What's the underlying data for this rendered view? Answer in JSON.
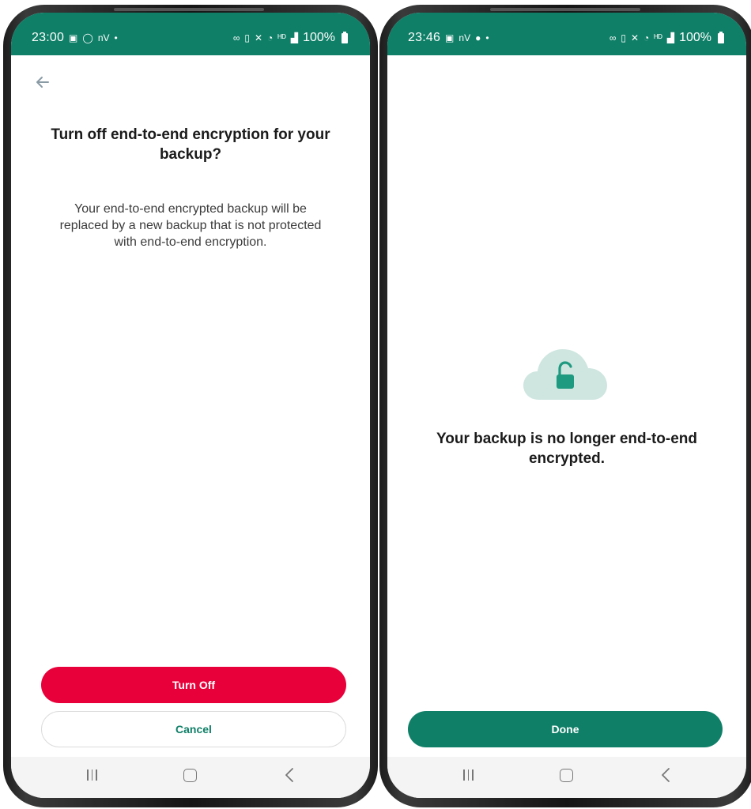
{
  "colors": {
    "brand_green": "#0f7f67",
    "danger_red": "#e8003a",
    "cloud_fill": "#cfe6e0",
    "lock_fill": "#1e9a80"
  },
  "left_screen": {
    "status": {
      "time": "23:00",
      "battery": "100%",
      "left_icons": [
        "gallery-icon",
        "whatsapp-icon",
        "nv-icon",
        "dot-icon"
      ],
      "right_icons": [
        "link-icon",
        "vibrate-icon",
        "mute-icon",
        "wifi-icon",
        "volte-icon",
        "signal-icon",
        "battery-icon"
      ]
    },
    "back_icon": "arrow-left-icon",
    "title": "Turn off end-to-end encryption for your backup?",
    "body": "Your end-to-end encrypted backup will be replaced by a new backup that is not protected with end-to-end encryption.",
    "buttons": {
      "turn_off": "Turn Off",
      "cancel": "Cancel"
    }
  },
  "right_screen": {
    "status": {
      "time": "23:46",
      "battery": "100%",
      "left_icons": [
        "gallery-icon",
        "nv-icon",
        "message-icon",
        "dot-icon"
      ],
      "right_icons": [
        "link-icon",
        "vibrate-icon",
        "mute-icon",
        "wifi-icon",
        "volte-icon",
        "signal-icon",
        "battery-icon"
      ]
    },
    "illustration": "cloud-unlocked-icon",
    "message": "Your backup is no longer end-to-end encrypted.",
    "buttons": {
      "done": "Done"
    }
  },
  "nav_bar": {
    "recents_icon": "recents-icon",
    "home_icon": "home-icon",
    "back_icon": "back-icon"
  }
}
